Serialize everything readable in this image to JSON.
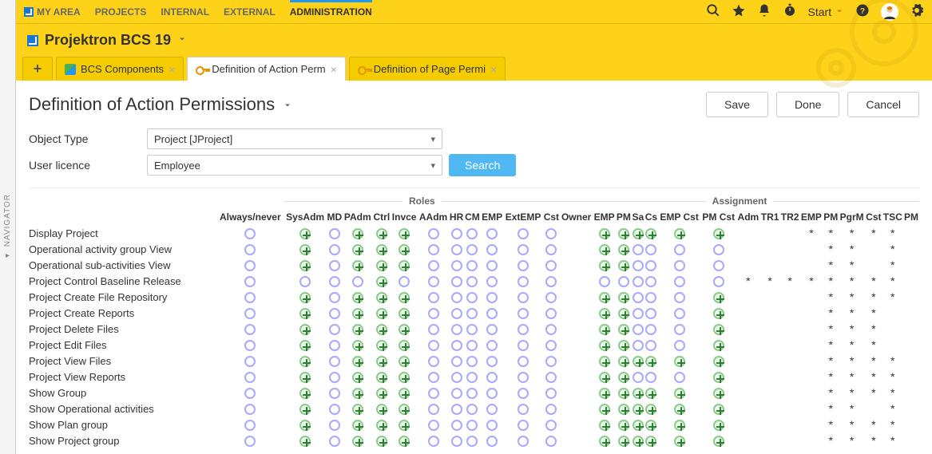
{
  "nav_strip": {
    "label": "NAVIGATOR"
  },
  "topnav": {
    "items": [
      "MY AREA",
      "PROJECTS",
      "INTERNAL",
      "EXTERNAL",
      "ADMINISTRATION"
    ],
    "active_index": 4,
    "start_label": "Start"
  },
  "brand": {
    "title": "Projektron BCS 19"
  },
  "tabs": [
    {
      "label": "BCS Components",
      "icon": "comp-icon",
      "active": false
    },
    {
      "label": "Definition of Action Perm",
      "icon": "key-icon",
      "active": true
    },
    {
      "label": "Definition of Page Permi",
      "icon": "key-icon",
      "active": false
    }
  ],
  "page": {
    "title": "Definition of Action Permissions",
    "buttons": {
      "save": "Save",
      "done": "Done",
      "cancel": "Cancel"
    }
  },
  "filters": {
    "object_type": {
      "label": "Object Type",
      "value": "Project [JProject]"
    },
    "user_licence": {
      "label": "User licence",
      "value": "Employee"
    },
    "search": "Search"
  },
  "matrix": {
    "sections": [
      {
        "title": "",
        "cols": [
          "Always/never"
        ]
      },
      {
        "title": "Roles",
        "cols": [
          "SysAdm",
          "MD",
          "PAdm",
          "Ctrl",
          "Invce",
          "AAdm",
          "HR",
          "CM",
          "EMP",
          "ExtEMP",
          "Cst"
        ]
      },
      {
        "title": "Assignment",
        "cols": [
          "Owner",
          "EMP",
          "PM",
          "Sa",
          "Cs",
          "EMP Cst",
          "PM Cst",
          "Adm",
          "TR1",
          "TR2",
          "EMP",
          "PM",
          "PgrM",
          "Cst",
          "TSC",
          "PM"
        ]
      }
    ],
    "rows": [
      {
        "label": "Display Project",
        "cells": [
          "o",
          "p",
          "o",
          "p",
          "p",
          "p",
          "o",
          "o",
          "o",
          "o",
          "o",
          "o",
          "",
          "p",
          "p",
          "p",
          "p",
          "p",
          "p",
          "",
          "",
          "",
          "*",
          "*",
          "*",
          "*",
          "*",
          ""
        ]
      },
      {
        "label": "Operational activity group View",
        "cells": [
          "o",
          "p",
          "o",
          "p",
          "p",
          "p",
          "o",
          "o",
          "o",
          "o",
          "o",
          "o",
          "",
          "p",
          "p",
          "o",
          "o",
          "o",
          "o",
          "",
          "",
          "",
          "",
          "*",
          "*",
          "",
          "*",
          ""
        ]
      },
      {
        "label": "Operational sub-activities View",
        "cells": [
          "o",
          "p",
          "o",
          "p",
          "p",
          "p",
          "o",
          "o",
          "o",
          "o",
          "o",
          "o",
          "",
          "p",
          "p",
          "o",
          "o",
          "o",
          "o",
          "",
          "",
          "",
          "",
          "*",
          "*",
          "",
          "*",
          ""
        ]
      },
      {
        "label": "Project Control Baseline Release",
        "cells": [
          "o",
          "o",
          "o",
          "o",
          "p",
          "o",
          "o",
          "o",
          "o",
          "o",
          "o",
          "o",
          "",
          "o",
          "o",
          "o",
          "o",
          "o",
          "o",
          "*",
          "*",
          "*",
          "*",
          "*",
          "*",
          "*",
          "*",
          ""
        ]
      },
      {
        "label": "Project Create File Repository",
        "cells": [
          "o",
          "p",
          "o",
          "p",
          "p",
          "p",
          "o",
          "o",
          "o",
          "o",
          "o",
          "o",
          "",
          "p",
          "p",
          "o",
          "o",
          "o",
          "p",
          "",
          "",
          "",
          "",
          "*",
          "*",
          "*",
          "*",
          ""
        ]
      },
      {
        "label": "Project Create Reports",
        "cells": [
          "o",
          "p",
          "o",
          "p",
          "p",
          "p",
          "o",
          "o",
          "o",
          "o",
          "o",
          "o",
          "",
          "p",
          "p",
          "o",
          "o",
          "o",
          "p",
          "",
          "",
          "",
          "",
          "*",
          "*",
          "*",
          "",
          ""
        ]
      },
      {
        "label": "Project Delete Files",
        "cells": [
          "o",
          "p",
          "o",
          "p",
          "p",
          "p",
          "o",
          "o",
          "o",
          "o",
          "o",
          "o",
          "",
          "p",
          "p",
          "o",
          "o",
          "o",
          "p",
          "",
          "",
          "",
          "",
          "*",
          "*",
          "*",
          "",
          ""
        ]
      },
      {
        "label": "Project Edit Files",
        "cells": [
          "o",
          "p",
          "o",
          "p",
          "p",
          "p",
          "o",
          "o",
          "o",
          "o",
          "o",
          "o",
          "",
          "p",
          "p",
          "o",
          "o",
          "o",
          "p",
          "",
          "",
          "",
          "",
          "*",
          "*",
          "*",
          "",
          ""
        ]
      },
      {
        "label": "Project View Files",
        "cells": [
          "o",
          "p",
          "o",
          "p",
          "p",
          "p",
          "o",
          "o",
          "o",
          "o",
          "o",
          "o",
          "",
          "p",
          "p",
          "p",
          "p",
          "p",
          "p",
          "",
          "",
          "",
          "",
          "*",
          "*",
          "*",
          "*",
          ""
        ]
      },
      {
        "label": "Project View Reports",
        "cells": [
          "o",
          "p",
          "o",
          "p",
          "p",
          "p",
          "o",
          "o",
          "o",
          "o",
          "o",
          "o",
          "",
          "p",
          "p",
          "o",
          "o",
          "o",
          "p",
          "",
          "",
          "",
          "",
          "*",
          "*",
          "*",
          "*",
          ""
        ]
      },
      {
        "label": "Show Group",
        "cells": [
          "o",
          "p",
          "o",
          "p",
          "p",
          "p",
          "o",
          "o",
          "o",
          "o",
          "o",
          "o",
          "",
          "p",
          "p",
          "p",
          "p",
          "p",
          "p",
          "",
          "",
          "",
          "",
          "*",
          "*",
          "*",
          "*",
          ""
        ]
      },
      {
        "label": "Show Operational activities",
        "cells": [
          "o",
          "p",
          "o",
          "p",
          "p",
          "p",
          "o",
          "o",
          "o",
          "o",
          "o",
          "o",
          "",
          "p",
          "p",
          "p",
          "p",
          "p",
          "p",
          "",
          "",
          "",
          "",
          "*",
          "*",
          "",
          "*",
          ""
        ]
      },
      {
        "label": "Show Plan group",
        "cells": [
          "o",
          "p",
          "o",
          "p",
          "p",
          "p",
          "o",
          "o",
          "o",
          "o",
          "o",
          "o",
          "",
          "p",
          "p",
          "p",
          "p",
          "p",
          "p",
          "",
          "",
          "",
          "",
          "*",
          "*",
          "*",
          "*",
          ""
        ]
      },
      {
        "label": "Show Project group",
        "cells": [
          "o",
          "p",
          "o",
          "p",
          "p",
          "p",
          "o",
          "o",
          "o",
          "o",
          "o",
          "o",
          "",
          "p",
          "p",
          "p",
          "p",
          "p",
          "p",
          "",
          "",
          "",
          "",
          "*",
          "*",
          "*",
          "*",
          ""
        ]
      }
    ]
  }
}
